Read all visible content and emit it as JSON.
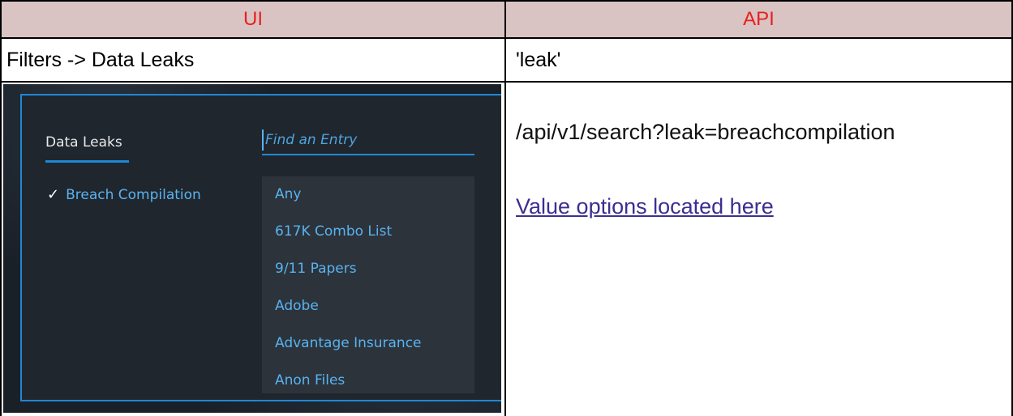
{
  "table": {
    "header": {
      "ui": "UI",
      "api": "API"
    },
    "row1": {
      "ui": "Filters -> Data Leaks",
      "api": "'leak'"
    },
    "row2": {
      "api_endpoint": "/api/v1/search?leak=breachcompilation",
      "api_link": "Value options located here"
    }
  },
  "app": {
    "tab_label": "Data Leaks",
    "search_placeholder": "Find an Entry",
    "selected_item": "Breach Compilation",
    "check_glyph": "✓",
    "list_items": [
      "Any",
      "617K Combo List",
      "9/11 Papers",
      "Adobe",
      "Advantage Insurance",
      "Anon Files"
    ]
  },
  "colors": {
    "header_background": "#d9c3c3",
    "header_text": "#e8201c",
    "link": "#3b2f8f",
    "app_accent": "#1e88d6",
    "app_item_text": "#59b3f0"
  }
}
